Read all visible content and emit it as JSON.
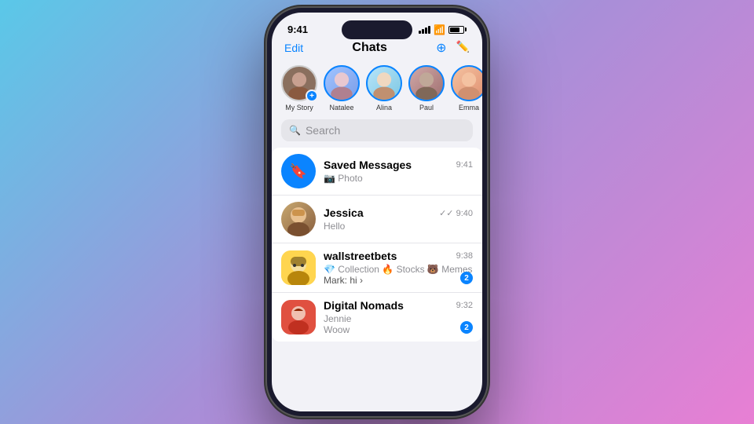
{
  "background": {
    "gradient_start": "#5ac8e8",
    "gradient_mid": "#a78fd8",
    "gradient_end": "#e87fd4"
  },
  "status_bar": {
    "time": "9:41",
    "signal_label": "signal",
    "wifi_label": "wifi",
    "battery_label": "battery"
  },
  "nav": {
    "edit_label": "Edit",
    "title": "Chats",
    "add_icon": "⊕",
    "compose_icon": "✏"
  },
  "stories": [
    {
      "id": "my-story",
      "label": "My Story",
      "css_class": "my-story",
      "has_add": true
    },
    {
      "id": "natalee",
      "label": "Natalee",
      "css_class": "natalee",
      "has_add": false
    },
    {
      "id": "alina",
      "label": "Alina",
      "css_class": "alina",
      "has_add": false
    },
    {
      "id": "paul",
      "label": "Paul",
      "css_class": "paul",
      "has_add": false
    },
    {
      "id": "emma",
      "label": "Emma",
      "css_class": "emma",
      "has_add": false
    }
  ],
  "search": {
    "placeholder": "Search"
  },
  "chats": [
    {
      "id": "saved-messages",
      "avatar_type": "saved",
      "avatar_emoji": "🔖",
      "name": "Saved Messages",
      "preview": "📷 Photo",
      "time": "9:41",
      "has_check": false,
      "badge": null
    },
    {
      "id": "jessica",
      "avatar_type": "jessica",
      "avatar_emoji": "👩",
      "name": "Jessica",
      "preview": "Hello",
      "time": "9:40",
      "has_check": true,
      "badge": null
    },
    {
      "id": "wallstreetbets",
      "avatar_type": "wstreetbets",
      "avatar_emoji": "🤵",
      "name": "wallstreetbets",
      "preview": "💎 Collection 🔥 Stocks 🐻 Memes...",
      "preview_sub": "Mark: hi ›",
      "time": "9:38",
      "has_check": false,
      "badge": "2"
    },
    {
      "id": "digital-nomads",
      "avatar_type": "digital",
      "avatar_emoji": "💃",
      "name": "Digital Nomads",
      "preview": "Jennie",
      "preview_sub": "Woow",
      "time": "9:32",
      "has_check": false,
      "badge": "2"
    }
  ]
}
